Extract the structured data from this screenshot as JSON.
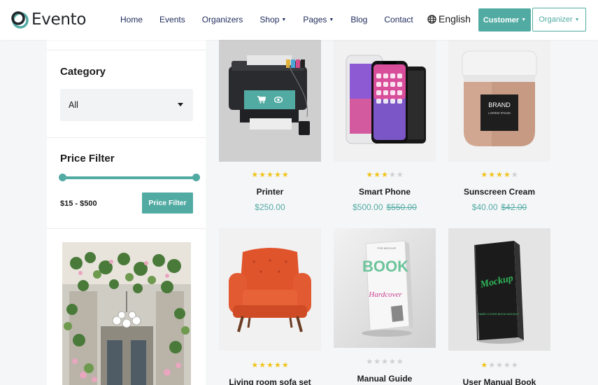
{
  "brand": {
    "name": "Evento"
  },
  "nav": {
    "items": [
      {
        "label": "Home",
        "dropdown": false
      },
      {
        "label": "Events",
        "dropdown": false
      },
      {
        "label": "Organizers",
        "dropdown": false
      },
      {
        "label": "Shop",
        "dropdown": true
      },
      {
        "label": "Pages",
        "dropdown": true
      },
      {
        "label": "Blog",
        "dropdown": false
      },
      {
        "label": "Contact",
        "dropdown": false
      }
    ],
    "language": "English",
    "customer_label": "Customer",
    "organizer_label": "Organizer"
  },
  "sidebar": {
    "category_title": "Category",
    "category_value": "All",
    "price_title": "Price Filter",
    "price_range": "$15 - $500",
    "price_button": "Price Filter"
  },
  "colors": {
    "accent": "#52aba3",
    "star": "#f0c419",
    "star_off": "#cfcfcf"
  },
  "products": [
    {
      "name": "Printer",
      "rating": 5,
      "price": "$250.00",
      "old_price": "",
      "hovered": true
    },
    {
      "name": "Smart Phone",
      "rating": 3,
      "price": "$500.00",
      "old_price": "$550.00",
      "hovered": false
    },
    {
      "name": "Sunscreen Cream",
      "rating": 4,
      "price": "$40.00",
      "old_price": "$42.00",
      "hovered": false
    },
    {
      "name": "Living room sofa set",
      "rating": 5,
      "price": "",
      "old_price": "",
      "hovered": false
    },
    {
      "name": "Manual Guide",
      "rating": 0,
      "price": "",
      "old_price": "",
      "hovered": false
    },
    {
      "name": "User Manual Book",
      "rating": 1,
      "price": "",
      "old_price": "",
      "hovered": false
    }
  ],
  "product_images": {
    "sunscreen_label_brand": "BRAND",
    "sunscreen_label_sub": "LOREM IPSUM",
    "book_title": "BOOK",
    "book_subtitle": "Hardcover",
    "book_badge": "PSD MOCKUP",
    "manual_title": "Mockup",
    "manual_caption": "HARD COVER BOOK MOCKUP"
  }
}
